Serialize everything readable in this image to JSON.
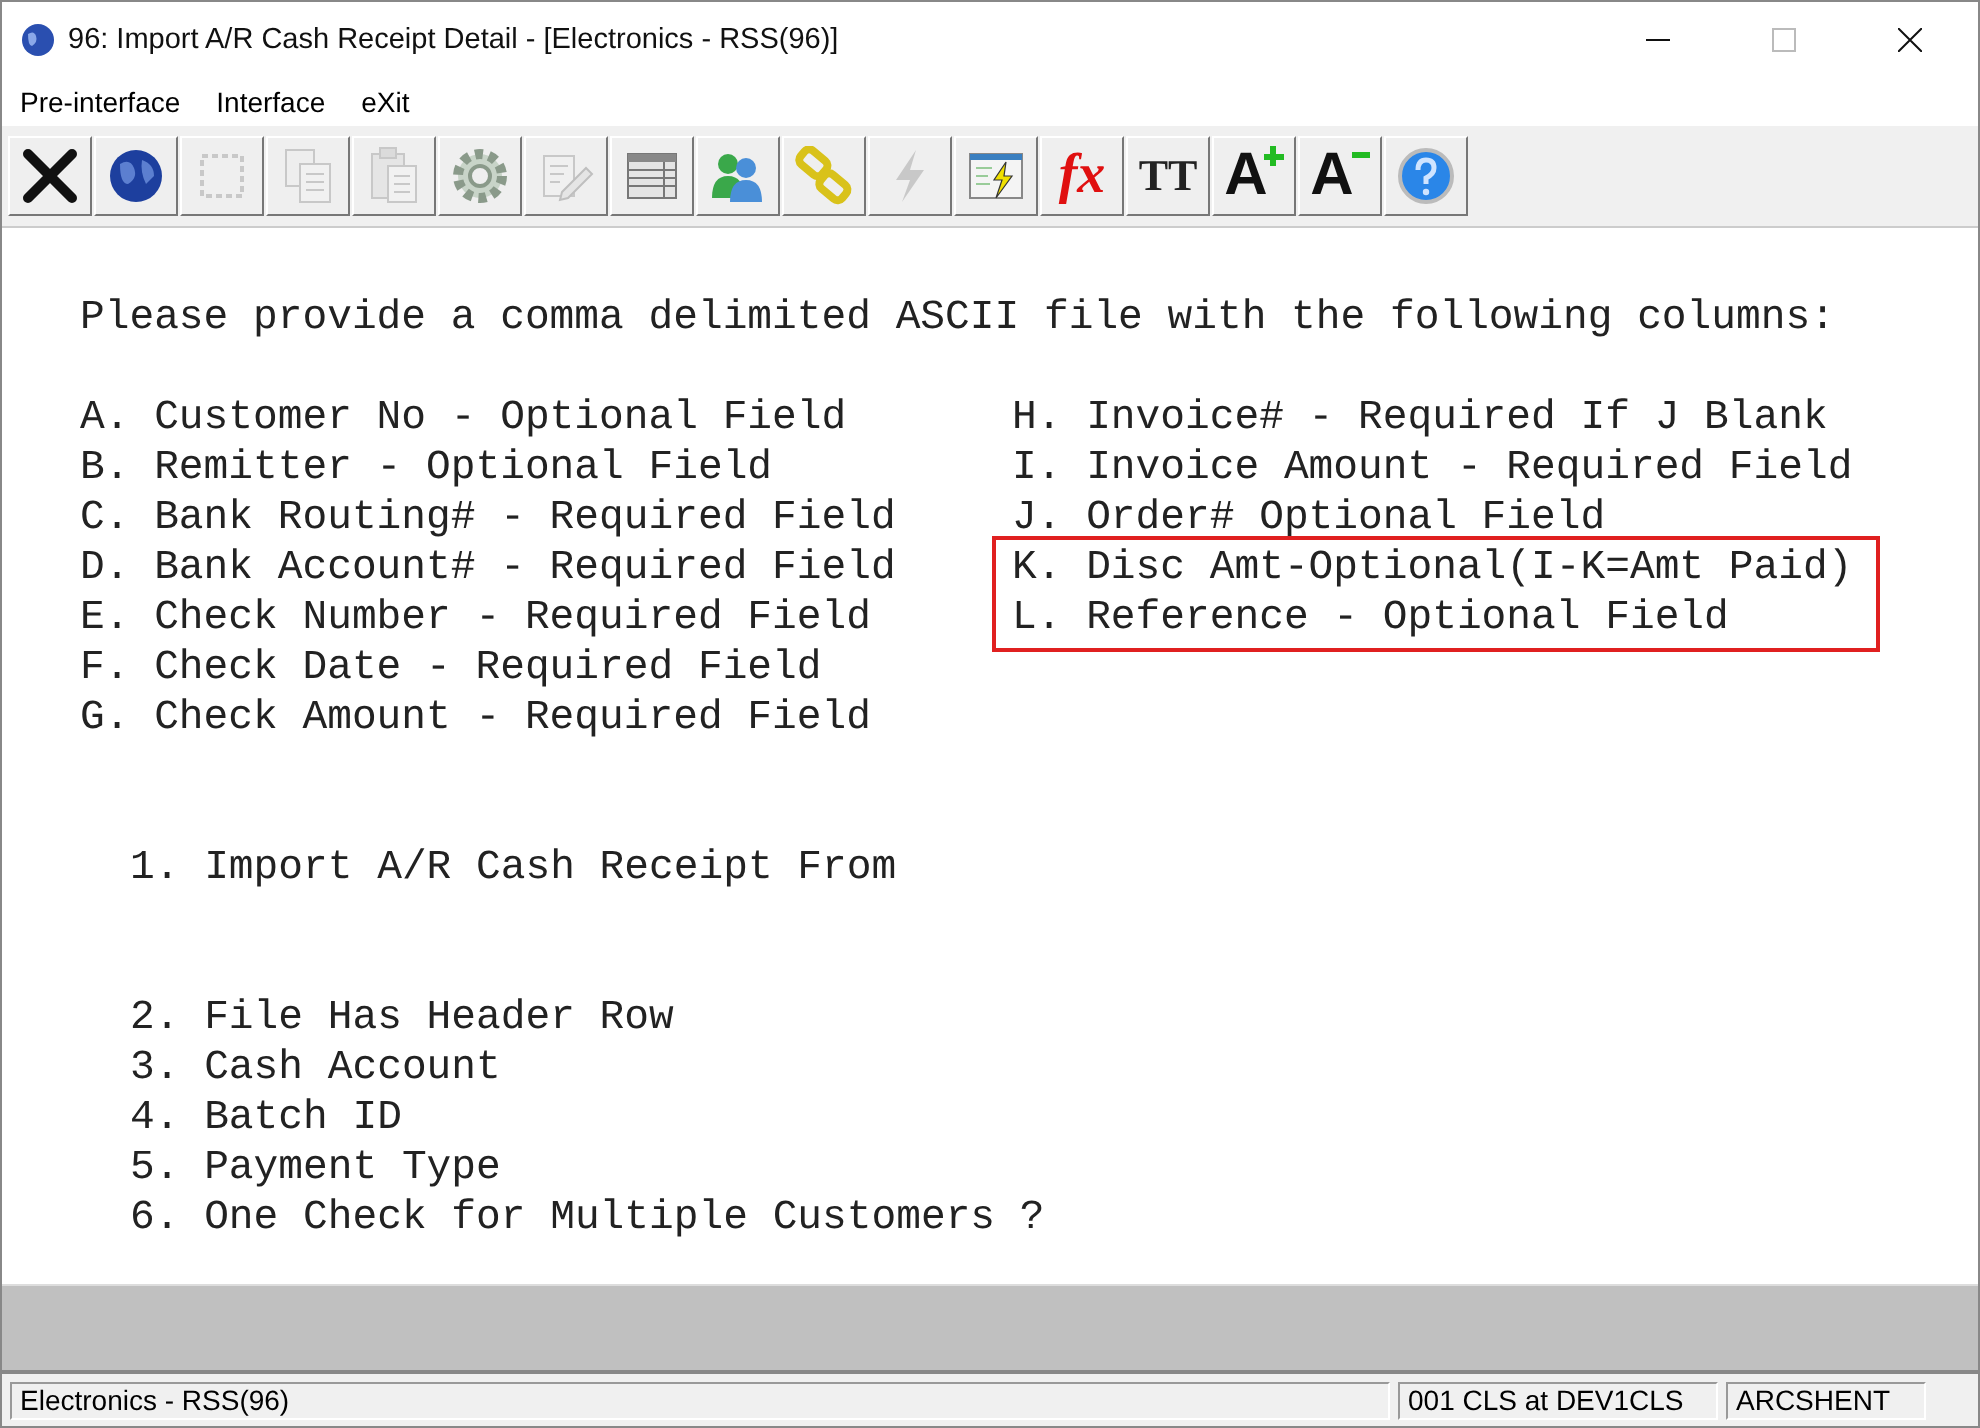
{
  "window": {
    "title": "96: Import A/R Cash Receipt Detail - [Electronics - RSS(96)]"
  },
  "menu": [
    {
      "label": "Pre-interface"
    },
    {
      "label": "Interface"
    },
    {
      "label": "eXit"
    }
  ],
  "toolbar": [
    {
      "kind": "close",
      "disabled": false
    },
    {
      "kind": "globe",
      "disabled": false
    },
    {
      "kind": "select",
      "disabled": true
    },
    {
      "kind": "copy",
      "disabled": true
    },
    {
      "kind": "paste",
      "disabled": true
    },
    {
      "kind": "gear",
      "disabled": false
    },
    {
      "kind": "edit",
      "disabled": true
    },
    {
      "kind": "table",
      "disabled": false
    },
    {
      "kind": "users",
      "disabled": false
    },
    {
      "kind": "link",
      "disabled": false
    },
    {
      "kind": "lightning",
      "disabled": true
    },
    {
      "kind": "run",
      "disabled": false
    },
    {
      "kind": "text",
      "label": "fx",
      "disabled": false
    },
    {
      "kind": "fonts",
      "label": "TT",
      "disabled": false
    },
    {
      "kind": "grow",
      "label": "A",
      "disabled": false
    },
    {
      "kind": "shrink",
      "label": "A",
      "disabled": false
    },
    {
      "kind": "help",
      "disabled": false
    }
  ],
  "instructions": "Please provide a comma delimited ASCII file with the following columns:",
  "columns_left": [
    "A. Customer No - Optional Field",
    "B. Remitter - Optional Field",
    "C. Bank Routing# - Required Field",
    "D. Bank Account# - Required Field",
    "E. Check Number - Required Field",
    "F. Check Date - Required Field",
    "G. Check Amount - Required Field"
  ],
  "columns_right": {
    "items": [
      "H. Invoice# - Required If J Blank",
      "I. Invoice Amount - Required Field",
      "J. Order# Optional Field"
    ],
    "boxed_items": [
      "K. Disc Amt-Optional(I-K=Amt Paid)",
      "L. Reference - Optional Field"
    ]
  },
  "prompts": [
    {
      "items": [
        "1. Import A/R Cash Receipt From"
      ]
    },
    {
      "items": [
        "2. File Has Header Row",
        "3. Cash Account",
        "4. Batch ID",
        "5. Payment Type",
        "6. One Check for Multiple Customers ?"
      ]
    }
  ],
  "status_bar": {
    "company": "Electronics - RSS(96)",
    "session": "001 CLS at DEV1CLS",
    "program": "ARCSHENT"
  }
}
